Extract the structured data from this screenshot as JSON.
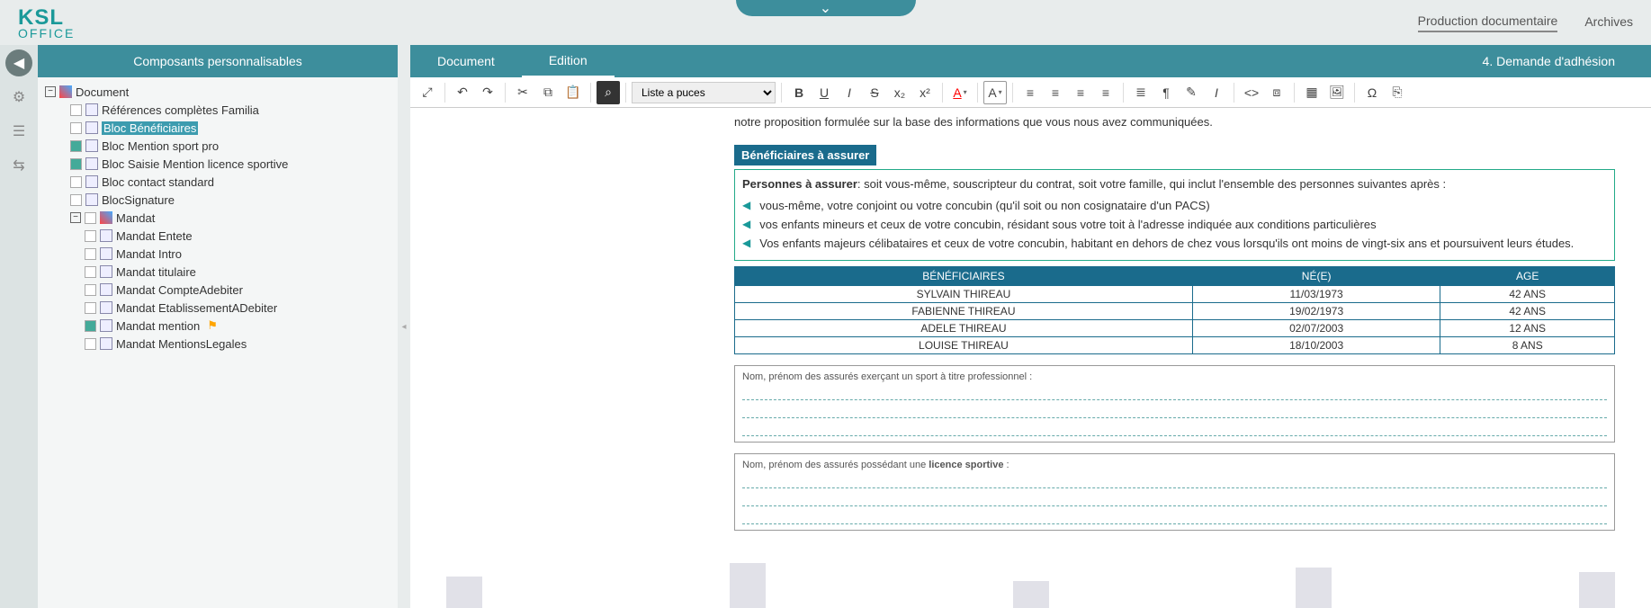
{
  "brand": {
    "name": "KSL",
    "sub": "OFFICE"
  },
  "topLinks": {
    "prod": "Production documentaire",
    "arch": "Archives"
  },
  "leftPanel": {
    "title": "Composants personnalisables"
  },
  "tree": {
    "root": "Document",
    "items": [
      "Références complètes Familia",
      "Bloc Bénéficiaires",
      "Bloc Mention sport pro",
      "Bloc Saisie Mention licence sportive",
      "Bloc contact standard",
      "BlocSignature"
    ],
    "mandat": "Mandat",
    "mandatItems": [
      "Mandat Entete",
      "Mandat Intro",
      "Mandat titulaire",
      "Mandat CompteAdebiter",
      "Mandat EtablissementADebiter",
      "Mandat mention",
      "Mandat MentionsLegales"
    ]
  },
  "rightTabs": {
    "doc": "Document",
    "edit": "Edition"
  },
  "rightTitle": "4. Demande d'adhésion",
  "toolbar": {
    "styleSelect": "Liste a puces"
  },
  "content": {
    "intro": "notre proposition formulée sur la base des informations que vous nous avez communiquées.",
    "blockTitle": "Bénéficiaires à assurer",
    "lead": "Personnes à assurer",
    "leadText": ": soit vous-même, souscripteur du contrat, soit votre famille, qui inclut l'ensemble des personnes suivantes après :",
    "bullets": [
      "vous-même, votre conjoint ou votre concubin (qu'il soit ou non cosignataire d'un PACS)",
      "vos enfants mineurs et ceux de votre concubin, résidant sous votre toit à l'adresse indiquée aux conditions particulières",
      "Vos enfants majeurs célibataires et ceux de votre concubin, habitant en dehors de chez vous lorsqu'ils ont moins de vingt-six ans et poursuivent leurs études."
    ],
    "tableHeaders": [
      "BÉNÉFICIAIRES",
      "NÉ(E)",
      "AGE"
    ],
    "tableRows": [
      [
        "SYLVAIN THIREAU",
        "11/03/1973",
        "42 ANS"
      ],
      [
        "FABIENNE THIREAU",
        "19/02/1973",
        "42 ANS"
      ],
      [
        "ADELE THIREAU",
        "02/07/2003",
        "12 ANS"
      ],
      [
        "LOUISE THIREAU",
        "18/10/2003",
        "8 ANS"
      ]
    ],
    "box1": "Nom, prénom des assurés exerçant un sport à titre professionnel :",
    "box2a": "Nom, prénom des assurés possédant une ",
    "box2b": "licence sportive",
    "box2c": " :"
  }
}
